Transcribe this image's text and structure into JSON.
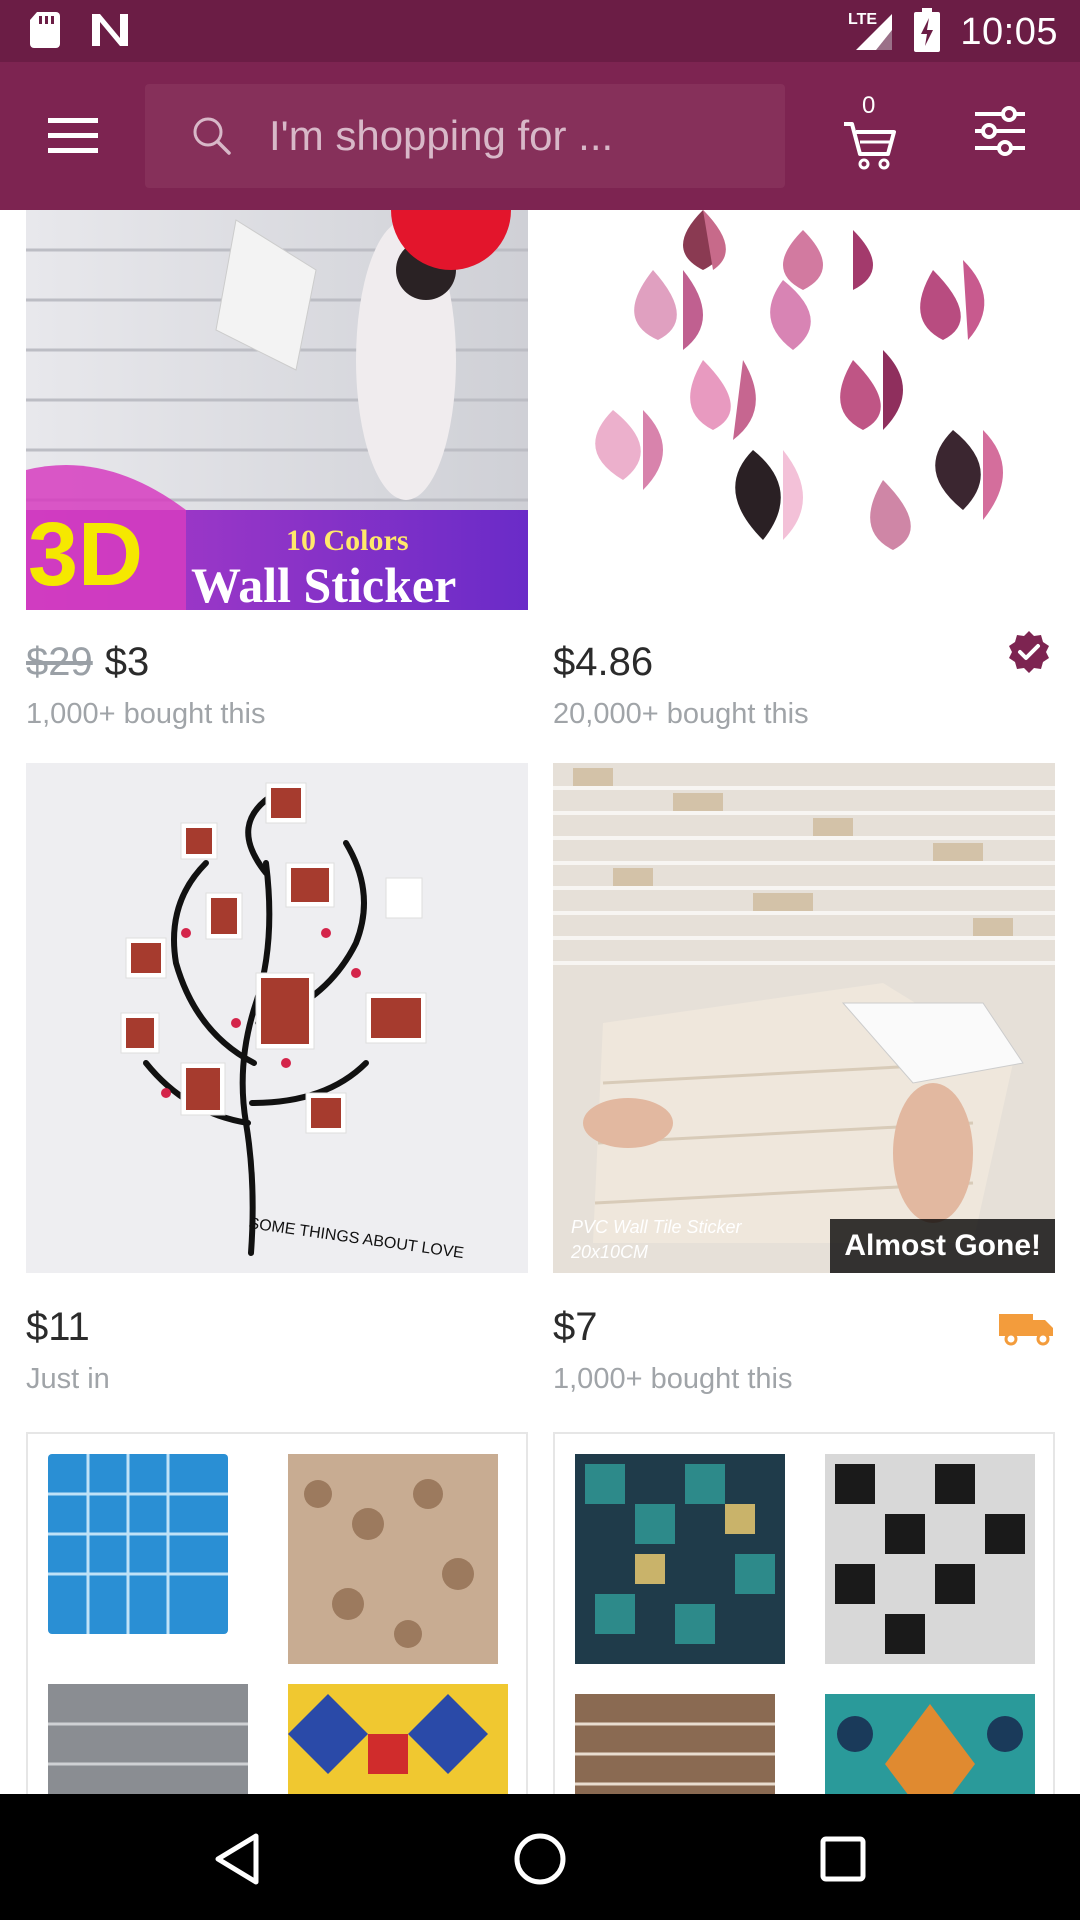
{
  "status_bar": {
    "time": "10:05",
    "network": "LTE",
    "icons": [
      "sd-card-icon",
      "n-notification-icon",
      "signal-icon",
      "battery-charging-icon"
    ]
  },
  "app_bar": {
    "search_placeholder": "I'm shopping for ...",
    "cart_count": "0",
    "icons": [
      "hamburger-menu-icon",
      "search-icon",
      "cart-icon",
      "filter-sliders-icon"
    ]
  },
  "products": [
    {
      "image_text": {
        "main": "Wall Sticker",
        "big": "3D",
        "colors": "10 Colors"
      },
      "old_price": "$29",
      "price": "$3",
      "sub": "1,000+ bought this",
      "badge": null
    },
    {
      "image_text": null,
      "old_price": null,
      "price": "$4.86",
      "sub": "20,000+ bought this",
      "badge": "verified-icon"
    },
    {
      "image_text": {
        "caption": "SOME THINGS ABOUT LOVE"
      },
      "old_price": null,
      "price": "$11",
      "sub": "Just in",
      "badge": null
    },
    {
      "image_text": {
        "overlay": "Almost Gone!",
        "label_line1": "PVC Wall Tile Sticker",
        "label_line2": "20x10CM"
      },
      "old_price": null,
      "price": "$7",
      "sub": "1,000+ bought this",
      "badge": "truck-icon"
    },
    {
      "image_text": null,
      "old_price": null,
      "price": null,
      "sub": null,
      "badge": null
    },
    {
      "image_text": null,
      "old_price": null,
      "price": null,
      "sub": null,
      "badge": null
    }
  ],
  "colors": {
    "status_bar": "#6b1d45",
    "app_bar": "#7d2451",
    "accent": "#7d2451",
    "truck": "#f39c3c"
  },
  "nav_bar": {
    "icons": [
      "back-triangle-icon",
      "home-circle-icon",
      "recents-square-icon"
    ]
  }
}
